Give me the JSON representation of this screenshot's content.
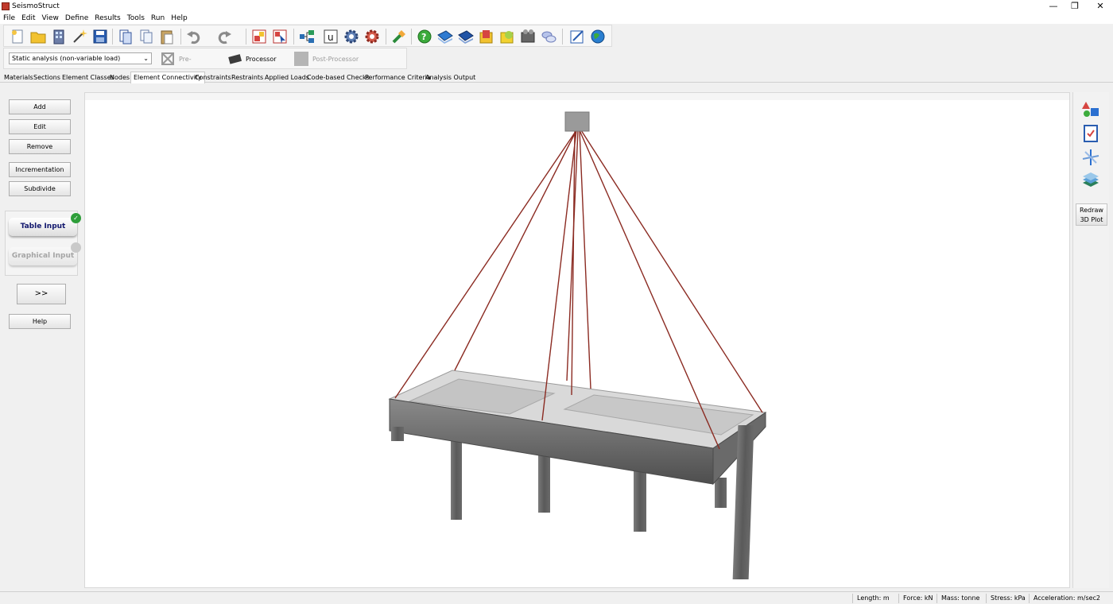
{
  "app": {
    "title": "SeismoStruct"
  },
  "menu": [
    "File",
    "Edit",
    "View",
    "Define",
    "Results",
    "Tools",
    "Run",
    "Help"
  ],
  "analysis": {
    "selected": "Static analysis (non-variable load)"
  },
  "modes": {
    "pre": "Pre-Processor",
    "proc": "Processor",
    "post": "Post-Processor"
  },
  "tabs": [
    "Materials",
    "Sections",
    "Element Classes",
    "Nodes",
    "Element Connectivity",
    "Constraints",
    "Restraints",
    "Applied Loads",
    "Code-based Checks",
    "Performance Criteria",
    "Analysis Output"
  ],
  "active_tab": "Element Connectivity",
  "left": {
    "add": "Add",
    "edit": "Edit",
    "remove": "Remove",
    "incrementation": "Incrementation",
    "subdivide": "Subdivide",
    "table_input": "Table Input",
    "graphical_input": "Graphical Input",
    "expand": ">>",
    "help": "Help"
  },
  "right": {
    "redraw_line1": "Redraw",
    "redraw_line2": "3D Plot"
  },
  "status": {
    "length": "Length: m",
    "force": "Force: kN",
    "mass": "Mass: tonne",
    "stress": "Stress: kPa",
    "acceleration": "Acceleration: m/sec2"
  },
  "colors": {
    "cable": "#8b2b22",
    "frame": "#6d6d6d",
    "slab": "#c9c9c9",
    "checkmark": "#2e9e3a"
  }
}
